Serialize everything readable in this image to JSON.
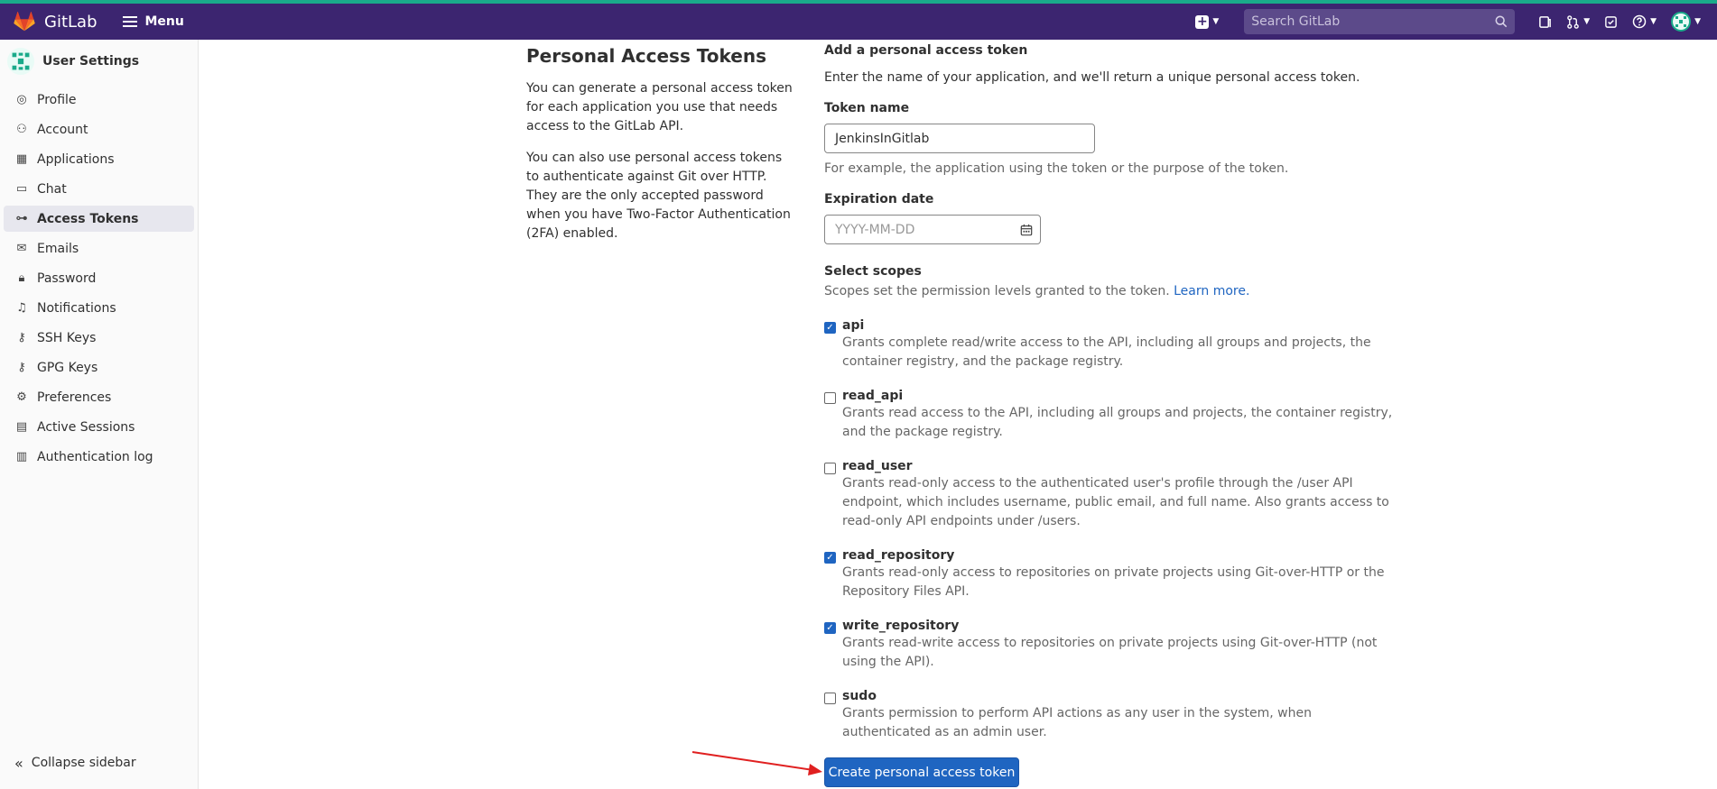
{
  "topbar": {
    "brand": "GitLab",
    "menu_label": "Menu",
    "search_placeholder": "Search GitLab"
  },
  "sidebar": {
    "title": "User Settings",
    "items": [
      {
        "label": "Profile",
        "icon": "profile-icon"
      },
      {
        "label": "Account",
        "icon": "account-icon"
      },
      {
        "label": "Applications",
        "icon": "applications-icon"
      },
      {
        "label": "Chat",
        "icon": "chat-icon"
      },
      {
        "label": "Access Tokens",
        "icon": "token-icon",
        "active": true
      },
      {
        "label": "Emails",
        "icon": "mail-icon"
      },
      {
        "label": "Password",
        "icon": "lock-icon"
      },
      {
        "label": "Notifications",
        "icon": "bell-icon"
      },
      {
        "label": "SSH Keys",
        "icon": "key-icon"
      },
      {
        "label": "GPG Keys",
        "icon": "key-icon"
      },
      {
        "label": "Preferences",
        "icon": "preferences-icon"
      },
      {
        "label": "Active Sessions",
        "icon": "sessions-icon"
      },
      {
        "label": "Authentication log",
        "icon": "log-icon"
      }
    ],
    "collapse_label": "Collapse sidebar"
  },
  "intro": {
    "title": "Personal Access Tokens",
    "p1": "You can generate a personal access token for each application you use that needs access to the GitLab API.",
    "p2": "You can also use personal access tokens to authenticate against Git over HTTP. They are the only accepted password when you have Two-Factor Authentication (2FA) enabled."
  },
  "form": {
    "heading": "Add a personal access token",
    "lead": "Enter the name of your application, and we'll return a unique personal access token.",
    "token_name_label": "Token name",
    "token_name_value": "JenkinsInGitlab",
    "token_name_help": "For example, the application using the token or the purpose of the token.",
    "expiration_label": "Expiration date",
    "expiration_placeholder": "YYYY-MM-DD",
    "scopes_label": "Select scopes",
    "scopes_help": "Scopes set the permission levels granted to the token.",
    "scopes_link": "Learn more.",
    "scopes": [
      {
        "name": "api",
        "checked": true,
        "desc": "Grants complete read/write access to the API, including all groups and projects, the container registry, and the package registry."
      },
      {
        "name": "read_api",
        "checked": false,
        "desc": "Grants read access to the API, including all groups and projects, the container registry, and the package registry."
      },
      {
        "name": "read_user",
        "checked": false,
        "desc": "Grants read-only access to the authenticated user's profile through the /user API endpoint, which includes username, public email, and full name. Also grants access to read-only API endpoints under /users."
      },
      {
        "name": "read_repository",
        "checked": true,
        "desc": "Grants read-only access to repositories on private projects using Git-over-HTTP or the Repository Files API."
      },
      {
        "name": "write_repository",
        "checked": true,
        "desc": "Grants read-write access to repositories on private projects using Git-over-HTTP (not using the API)."
      },
      {
        "name": "sudo",
        "checked": false,
        "desc": "Grants permission to perform API actions as any user in the system, when authenticated as an admin user."
      }
    ],
    "submit_label": "Create personal access token"
  }
}
